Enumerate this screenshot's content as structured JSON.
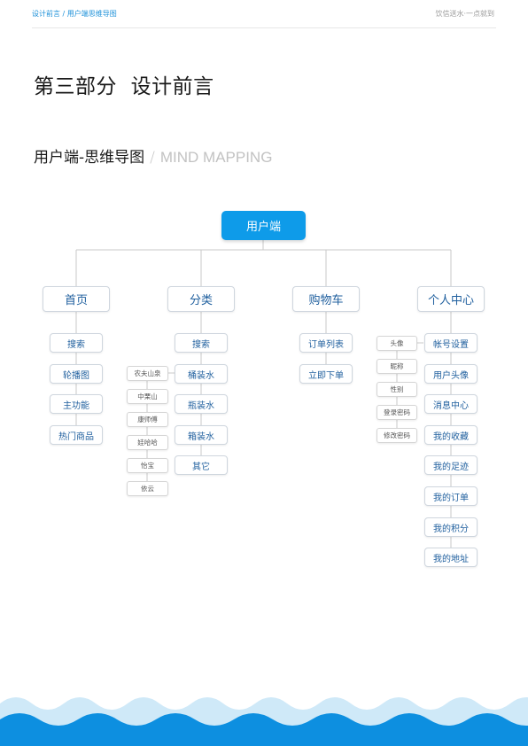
{
  "header": {
    "breadcrumb": "设计前言 / 用户端思维导图",
    "slogan": "饮信送水·一点就到"
  },
  "page_title": "第三部分  设计前言",
  "subtitle": {
    "cn": "用户端-思维导图",
    "sep": "/",
    "en": "MIND MAPPING"
  },
  "mindmap": {
    "root": "用户端",
    "branches": [
      {
        "label": "首页",
        "items": [
          "搜索",
          "轮播图",
          "主功能",
          "热门商品"
        ]
      },
      {
        "label": "分类",
        "items": [
          "搜索",
          "桶装水",
          "瓶装水",
          "箱装水",
          "其它"
        ],
        "sub_items": [
          "农夫山泉",
          "中栗山",
          "康师傅",
          "娃哈哈",
          "怡宝",
          "依云"
        ]
      },
      {
        "label": "购物车",
        "items": [
          "订单列表",
          "立即下单"
        ]
      },
      {
        "label": "个人中心",
        "items": [
          "帐号设置",
          "用户头像",
          "消息中心",
          "我的收藏",
          "我的足迹",
          "我的订单",
          "我的积分",
          "我的地址"
        ],
        "sub_items": [
          "头像",
          "昵称",
          "性别",
          "登录密码",
          "修改密码"
        ]
      }
    ]
  },
  "colors": {
    "accent": "#0e9be9",
    "node_text": "#1f5f9e",
    "wave_light": "#cfe9f8",
    "wave_dark": "#0d8fe0"
  }
}
